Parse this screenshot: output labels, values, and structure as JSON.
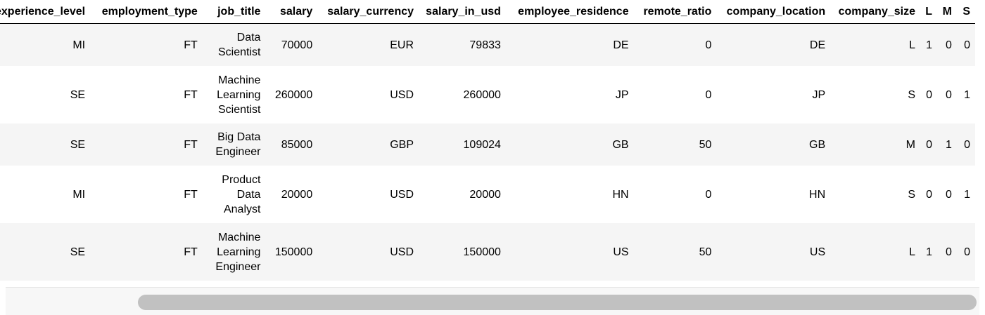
{
  "table": {
    "columns": [
      "experience_level",
      "employment_type",
      "job_title",
      "salary",
      "salary_currency",
      "salary_in_usd",
      "employee_residence",
      "remote_ratio",
      "company_location",
      "company_size",
      "L",
      "M",
      "S"
    ],
    "rows": [
      [
        "MI",
        "FT",
        "Data Scientist",
        "70000",
        "EUR",
        "79833",
        "DE",
        "0",
        "DE",
        "L",
        "1",
        "0",
        "0"
      ],
      [
        "SE",
        "FT",
        "Machine Learning Scientist",
        "260000",
        "USD",
        "260000",
        "JP",
        "0",
        "JP",
        "S",
        "0",
        "0",
        "1"
      ],
      [
        "SE",
        "FT",
        "Big Data Engineer",
        "85000",
        "GBP",
        "109024",
        "GB",
        "50",
        "GB",
        "M",
        "0",
        "1",
        "0"
      ],
      [
        "MI",
        "FT",
        "Product Data Analyst",
        "20000",
        "USD",
        "20000",
        "HN",
        "0",
        "HN",
        "S",
        "0",
        "0",
        "1"
      ],
      [
        "SE",
        "FT",
        "Machine Learning Engineer",
        "150000",
        "USD",
        "150000",
        "US",
        "50",
        "US",
        "L",
        "1",
        "0",
        "0"
      ]
    ]
  },
  "scrollbar": {
    "orientation": "horizontal",
    "color": "#c1c1c1"
  },
  "colors": {
    "row_stripe": "#f5f5f5",
    "header_border": "#000000"
  }
}
